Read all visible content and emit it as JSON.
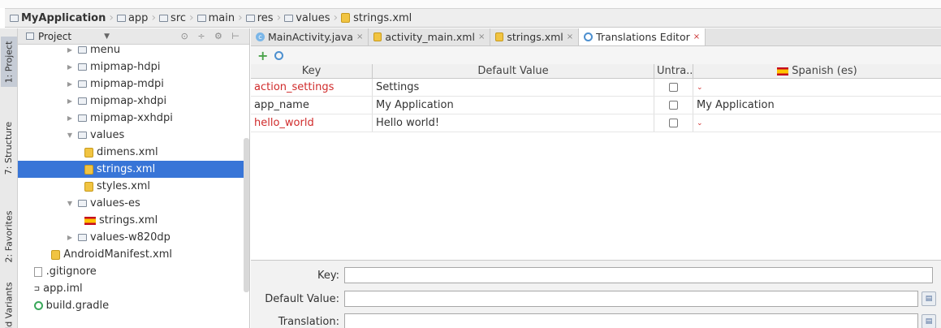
{
  "breadcrumb": [
    "MyApplication",
    "app",
    "src",
    "main",
    "res",
    "values",
    "strings.xml"
  ],
  "left_tabs": [
    "1: Project",
    "7: Structure",
    "2: Favorites",
    "Build Variants"
  ],
  "project": {
    "header": "Project",
    "tree": [
      {
        "label": "menu",
        "type": "folder",
        "indent": 2,
        "expanded": false
      },
      {
        "label": "mipmap-hdpi",
        "type": "folder",
        "indent": 2,
        "expanded": false
      },
      {
        "label": "mipmap-mdpi",
        "type": "folder",
        "indent": 2,
        "expanded": false
      },
      {
        "label": "mipmap-xhdpi",
        "type": "folder",
        "indent": 2,
        "expanded": false
      },
      {
        "label": "mipmap-xxhdpi",
        "type": "folder",
        "indent": 2,
        "expanded": false
      },
      {
        "label": "values",
        "type": "folder",
        "indent": 2,
        "expanded": true
      },
      {
        "label": "dimens.xml",
        "type": "xml",
        "indent": 3
      },
      {
        "label": "strings.xml",
        "type": "xml",
        "indent": 3,
        "selected": true
      },
      {
        "label": "styles.xml",
        "type": "xml",
        "indent": 3
      },
      {
        "label": "values-es",
        "type": "folder",
        "indent": 2,
        "expanded": true
      },
      {
        "label": "strings.xml",
        "type": "flag",
        "indent": 3
      },
      {
        "label": "values-w820dp",
        "type": "folder",
        "indent": 2,
        "expanded": false
      },
      {
        "label": "AndroidManifest.xml",
        "type": "xml",
        "indent": 1.3
      },
      {
        "label": ".gitignore",
        "type": "doc",
        "indent": 0.4
      },
      {
        "label": "app.iml",
        "type": "iml",
        "indent": 0.4
      },
      {
        "label": "build.gradle",
        "type": "gradle",
        "indent": 0.4
      }
    ]
  },
  "tabs": [
    {
      "label": "MainActivity.java",
      "icon": "java-class-icon"
    },
    {
      "label": "activity_main.xml",
      "icon": "xml-file-icon"
    },
    {
      "label": "strings.xml",
      "icon": "xml-file-icon"
    },
    {
      "label": "Translations Editor",
      "icon": "globe-icon",
      "active": true
    }
  ],
  "table": {
    "headers": [
      "Key",
      "Default Value",
      "Untra...",
      "Spanish (es)"
    ],
    "rows": [
      {
        "key": "action_settings",
        "default": "Settings",
        "untranslatable": false,
        "spanish": "",
        "missing": true
      },
      {
        "key": "app_name",
        "default": "My Application",
        "untranslatable": false,
        "spanish": "My Application",
        "missing": false
      },
      {
        "key": "hello_world",
        "default": "Hello world!",
        "untranslatable": false,
        "spanish": "",
        "missing": true
      }
    ]
  },
  "editor": {
    "key_label": "Key:",
    "default_label": "Default Value:",
    "translation_label": "Translation:"
  }
}
